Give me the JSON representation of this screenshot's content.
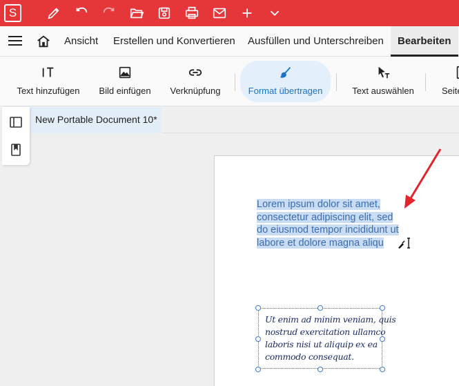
{
  "app": {
    "logo_letter": "S"
  },
  "titlebar": {
    "icons": [
      "pen-icon",
      "undo-icon",
      "redo-icon",
      "open-folder-icon",
      "save-icon",
      "print-icon",
      "mail-icon",
      "plus-icon",
      "chevron-down-icon"
    ]
  },
  "menubar": {
    "items": [
      {
        "label": "Ansicht"
      },
      {
        "label": "Erstellen und Konvertieren"
      },
      {
        "label": "Ausfüllen und Unterschreiben"
      },
      {
        "label": "Bearbeiten"
      }
    ],
    "active": "Bearbeiten"
  },
  "ribbon": {
    "buttons": [
      {
        "label": "Text hinzufügen",
        "icon": "add-text-icon"
      },
      {
        "label": "Bild einfügen",
        "icon": "image-icon"
      },
      {
        "label": "Verknüpfung",
        "icon": "link-icon"
      },
      {
        "label": "Format übertragen",
        "icon": "format-painter-icon"
      },
      {
        "label": "Text auswählen",
        "icon": "select-text-icon"
      },
      {
        "label": "Seite"
      }
    ],
    "active": "Format übertragen"
  },
  "document": {
    "tab_title": "New Portable Document 10*",
    "selected_text_lines": [
      "Lorem ipsum dolor sit amet,",
      "consectetur adipiscing elit, sed",
      "do eiusmod tempor incididunt ut",
      "labore et dolore magna aliqu"
    ],
    "signature_text_lines": [
      "Ut enim ad minim veniam, quis",
      "nostrud exercitation ullamco",
      "laboris nisi ut aliquip ex ea",
      "commodo consequat."
    ]
  },
  "colors": {
    "brand_red": "#e5373a",
    "accent_blue": "#1a73c8",
    "selection": "#c9dcf2",
    "annotation_arrow": "#e5232a"
  }
}
